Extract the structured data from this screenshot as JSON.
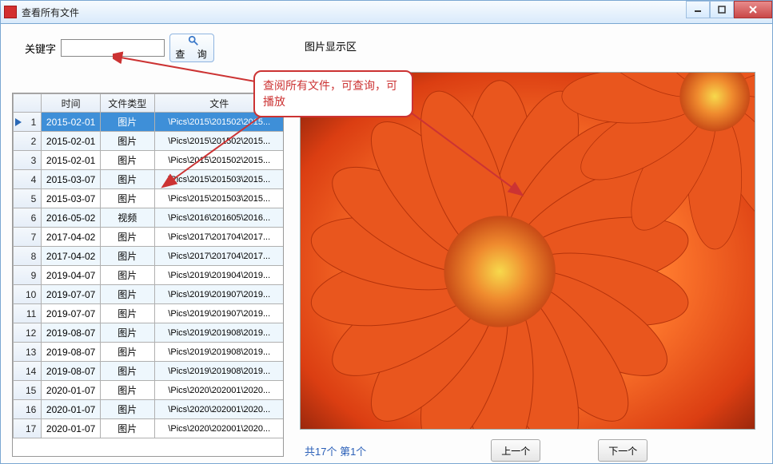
{
  "window": {
    "title": "查看所有文件"
  },
  "search": {
    "label": "关键字",
    "value": "",
    "query_button": "查  询"
  },
  "preview": {
    "label": "图片显示区"
  },
  "table": {
    "headers": {
      "rownum": "",
      "date": "时间",
      "type": "文件类型",
      "file": "文件"
    },
    "rows": [
      {
        "n": 1,
        "date": "2015-02-01",
        "type": "图片",
        "file": "\\Pics\\2015\\201502\\2015..."
      },
      {
        "n": 2,
        "date": "2015-02-01",
        "type": "图片",
        "file": "\\Pics\\2015\\201502\\2015..."
      },
      {
        "n": 3,
        "date": "2015-02-01",
        "type": "图片",
        "file": "\\Pics\\2015\\201502\\2015..."
      },
      {
        "n": 4,
        "date": "2015-03-07",
        "type": "图片",
        "file": "\\Pics\\2015\\201503\\2015..."
      },
      {
        "n": 5,
        "date": "2015-03-07",
        "type": "图片",
        "file": "\\Pics\\2015\\201503\\2015..."
      },
      {
        "n": 6,
        "date": "2016-05-02",
        "type": "视频",
        "file": "\\Pics\\2016\\201605\\2016..."
      },
      {
        "n": 7,
        "date": "2017-04-02",
        "type": "图片",
        "file": "\\Pics\\2017\\201704\\2017..."
      },
      {
        "n": 8,
        "date": "2017-04-02",
        "type": "图片",
        "file": "\\Pics\\2017\\201704\\2017..."
      },
      {
        "n": 9,
        "date": "2019-04-07",
        "type": "图片",
        "file": "\\Pics\\2019\\201904\\2019..."
      },
      {
        "n": 10,
        "date": "2019-07-07",
        "type": "图片",
        "file": "\\Pics\\2019\\201907\\2019..."
      },
      {
        "n": 11,
        "date": "2019-07-07",
        "type": "图片",
        "file": "\\Pics\\2019\\201907\\2019..."
      },
      {
        "n": 12,
        "date": "2019-08-07",
        "type": "图片",
        "file": "\\Pics\\2019\\201908\\2019..."
      },
      {
        "n": 13,
        "date": "2019-08-07",
        "type": "图片",
        "file": "\\Pics\\2019\\201908\\2019..."
      },
      {
        "n": 14,
        "date": "2019-08-07",
        "type": "图片",
        "file": "\\Pics\\2019\\201908\\2019..."
      },
      {
        "n": 15,
        "date": "2020-01-07",
        "type": "图片",
        "file": "\\Pics\\2020\\202001\\2020..."
      },
      {
        "n": 16,
        "date": "2020-01-07",
        "type": "图片",
        "file": "\\Pics\\2020\\202001\\2020..."
      },
      {
        "n": 17,
        "date": "2020-01-07",
        "type": "图片",
        "file": "\\Pics\\2020\\202001\\2020..."
      }
    ],
    "selected_index": 0
  },
  "status": {
    "text": "共17个   第1个"
  },
  "nav": {
    "prev": "上一个",
    "next": "下一个"
  },
  "callout": {
    "text": "查阅所有文件，可查询，可播放"
  }
}
